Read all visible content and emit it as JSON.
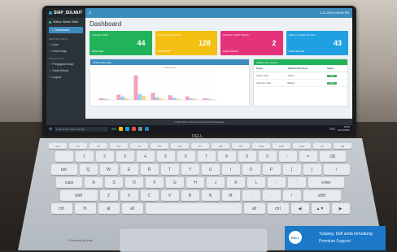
{
  "app": {
    "brand": "SIAP_SULMUT",
    "user_status": "Status: Admin Sisfo"
  },
  "sidebar": {
    "items": [
      {
        "label": "Dashboard",
        "active": true
      },
      {
        "section": "MASTER DATA"
      },
      {
        "label": "User"
      },
      {
        "label": "Kode Arsip"
      },
      {
        "section": "TRANSAKSI"
      },
      {
        "label": "Pengajuan Arsip"
      },
      {
        "label": "Surat Keluar"
      },
      {
        "label": "Logout"
      }
    ]
  },
  "topbar": {
    "datetime": "1-11-2024 4:50:00 PM"
  },
  "main": {
    "title": "Dashboard",
    "stat_boxes": [
      {
        "label": "JUMLAH USER",
        "value": "44",
        "footer": "DATA USER",
        "color": "#21b35a"
      },
      {
        "label": "JUMLAH KODE ARSIP",
        "value": "128",
        "footer": "KODE ARSIP",
        "color": "#f3c012"
      },
      {
        "label": "JUMLAH SURAT MASUK",
        "value": "2",
        "footer": "SURAT MASUK",
        "color": "#e5337a"
      },
      {
        "label": "JUMLAH SURAT KELUAR",
        "value": "43",
        "footer": "SURAT KELUAR",
        "color": "#1fa0e0"
      }
    ],
    "chart_panel": {
      "header": "Grafik Data Arsip",
      "header_color": "#3c8dbc",
      "chart_title": "Grafik Arsip"
    },
    "table_panel": {
      "header": "Status User Online",
      "header_color": "#21b35a",
      "columns": [
        "Nama",
        "Jabatan/Unit Kerja",
        "Status"
      ],
      "rows": [
        [
          "Admin Sisfo",
          "Admin",
          "Online"
        ],
        [
          "Operator Arsip",
          "Bidang",
          "Online"
        ]
      ]
    },
    "footer": "© 2024 Sistem Informasi Arsip Pemerintah Kabupaten"
  },
  "chart_data": {
    "type": "bar",
    "categories": [
      "1",
      "2",
      "3",
      "4",
      "5",
      "6",
      "7"
    ],
    "series": [
      {
        "values": [
          3,
          9,
          42,
          12,
          8,
          6,
          3
        ],
        "color": "#f3a3b8"
      },
      {
        "values": [
          2,
          6,
          10,
          5,
          4,
          3,
          2
        ],
        "color": "#9fd1f0"
      },
      {
        "values": [
          1,
          3,
          7,
          3,
          2,
          2,
          1
        ],
        "color": "#f7d98b"
      }
    ],
    "ylim": [
      0,
      50
    ],
    "title": "Grafik Arsip"
  },
  "taskbar": {
    "search_placeholder": "Ketik di sini untuk mencari",
    "stock": "-954",
    "weather": "29°C",
    "time": "16:50",
    "date": "01/11/2024"
  },
  "laptop": {
    "brand_logo": "DELL",
    "sticker_line1": "Tunjang. Dell anda terhubung",
    "sticker_line2": "Premium Support",
    "sticker_logo": "DELL",
    "bottom_label": "Powered by Intel"
  },
  "keyboard": {
    "rows": [
      [
        "esc",
        "F1",
        "F2",
        "F3",
        "F4",
        "F5",
        "F6",
        "F7",
        "F8",
        "F9",
        "F10",
        "F11",
        "F12",
        "prt",
        "del"
      ],
      [
        "`",
        "1",
        "2",
        "3",
        "4",
        "5",
        "6",
        "7",
        "8",
        "9",
        "0",
        "-",
        "=",
        "⌫"
      ],
      [
        "tab",
        "Q",
        "W",
        "E",
        "R",
        "T",
        "Y",
        "U",
        "I",
        "O",
        "P",
        "[",
        "]",
        "\\"
      ],
      [
        "caps",
        "A",
        "S",
        "D",
        "F",
        "G",
        "H",
        "J",
        "K",
        "L",
        ";",
        "'",
        "enter"
      ],
      [
        "shift",
        "Z",
        "X",
        "C",
        "V",
        "B",
        "N",
        "M",
        ",",
        ".",
        "/",
        "shift"
      ],
      [
        "ctrl",
        "fn",
        "⊞",
        "alt",
        "",
        "alt",
        "ctrl",
        "◀",
        "▲▼",
        "▶"
      ]
    ]
  }
}
